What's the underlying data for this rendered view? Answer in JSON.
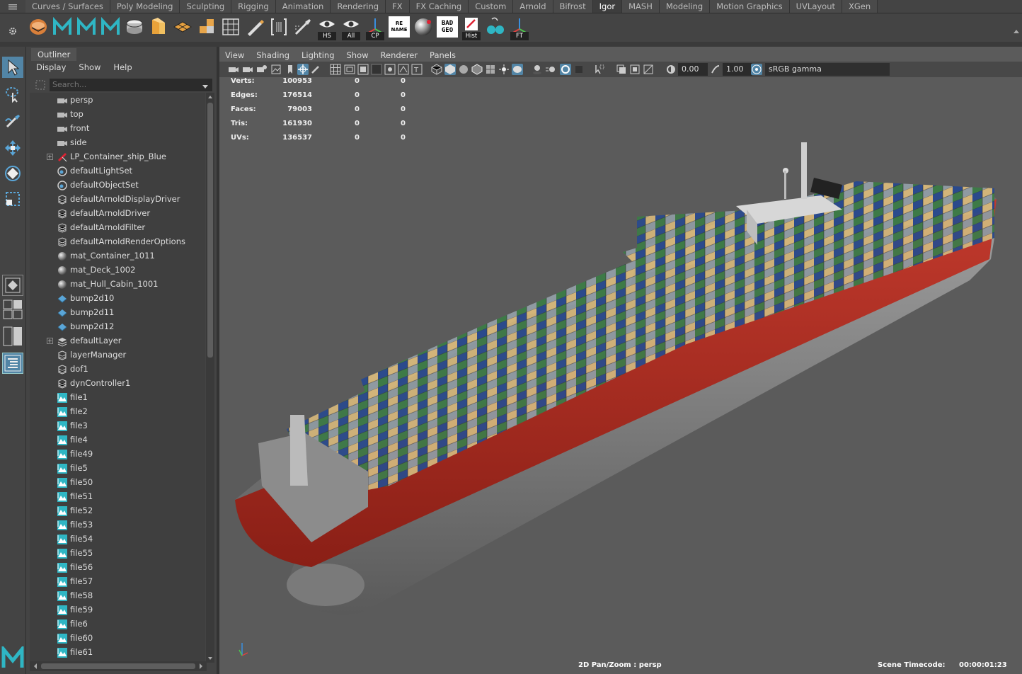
{
  "shelf": {
    "tabs": [
      "Curves / Surfaces",
      "Poly Modeling",
      "Sculpting",
      "Rigging",
      "Animation",
      "Rendering",
      "FX",
      "FX Caching",
      "Custom",
      "Arnold",
      "Bifrost",
      "Igor",
      "MASH",
      "Modeling",
      "Motion Graphics",
      "UVLayout",
      "XGen"
    ],
    "active_tab": "Igor",
    "icon_labels": {
      "hs": "HS",
      "all": "All",
      "cp": "CP",
      "rename": "RE NAME",
      "badgeo": "BAD GEO",
      "hist": "Hist",
      "ft": "FT"
    }
  },
  "outliner": {
    "tab": "Outliner",
    "menu": [
      "Display",
      "Show",
      "Help"
    ],
    "search_placeholder": "Search...",
    "items": [
      {
        "label": "persp",
        "icon": "camera-icon",
        "expandable": false
      },
      {
        "label": "top",
        "icon": "camera-icon",
        "expandable": false
      },
      {
        "label": "front",
        "icon": "camera-icon",
        "expandable": false
      },
      {
        "label": "side",
        "icon": "camera-icon",
        "expandable": false
      },
      {
        "label": "LP_Container_ship_Blue",
        "icon": "mesh-group-icon",
        "expandable": true
      },
      {
        "label": "defaultLightSet",
        "icon": "set-icon",
        "expandable": false
      },
      {
        "label": "defaultObjectSet",
        "icon": "set-icon",
        "expandable": false
      },
      {
        "label": "defaultArnoldDisplayDriver",
        "icon": "node-icon",
        "expandable": false
      },
      {
        "label": "defaultArnoldDriver",
        "icon": "node-icon",
        "expandable": false
      },
      {
        "label": "defaultArnoldFilter",
        "icon": "node-icon",
        "expandable": false
      },
      {
        "label": "defaultArnoldRenderOptions",
        "icon": "node-icon",
        "expandable": false
      },
      {
        "label": "mat_Container_1011",
        "icon": "material-sphere-icon",
        "expandable": false
      },
      {
        "label": "mat_Deck_1002",
        "icon": "material-sphere-icon",
        "expandable": false
      },
      {
        "label": "mat_Hull_Cabin_1001",
        "icon": "material-sphere-icon",
        "expandable": false
      },
      {
        "label": "bump2d10",
        "icon": "bump-icon",
        "expandable": false
      },
      {
        "label": "bump2d11",
        "icon": "bump-icon",
        "expandable": false
      },
      {
        "label": "bump2d12",
        "icon": "bump-icon",
        "expandable": false
      },
      {
        "label": "defaultLayer",
        "icon": "layer-icon",
        "expandable": true
      },
      {
        "label": "layerManager",
        "icon": "node-icon",
        "expandable": false
      },
      {
        "label": "dof1",
        "icon": "node-icon",
        "expandable": false
      },
      {
        "label": "dynController1",
        "icon": "node-icon",
        "expandable": false
      },
      {
        "label": "file1",
        "icon": "file-texture-icon",
        "expandable": false
      },
      {
        "label": "file2",
        "icon": "file-texture-icon",
        "expandable": false
      },
      {
        "label": "file3",
        "icon": "file-texture-icon",
        "expandable": false
      },
      {
        "label": "file4",
        "icon": "file-texture-icon",
        "expandable": false
      },
      {
        "label": "file49",
        "icon": "file-texture-icon",
        "expandable": false
      },
      {
        "label": "file5",
        "icon": "file-texture-icon",
        "expandable": false
      },
      {
        "label": "file50",
        "icon": "file-texture-icon",
        "expandable": false
      },
      {
        "label": "file51",
        "icon": "file-texture-icon",
        "expandable": false
      },
      {
        "label": "file52",
        "icon": "file-texture-icon",
        "expandable": false
      },
      {
        "label": "file53",
        "icon": "file-texture-icon",
        "expandable": false
      },
      {
        "label": "file54",
        "icon": "file-texture-icon",
        "expandable": false
      },
      {
        "label": "file55",
        "icon": "file-texture-icon",
        "expandable": false
      },
      {
        "label": "file56",
        "icon": "file-texture-icon",
        "expandable": false
      },
      {
        "label": "file57",
        "icon": "file-texture-icon",
        "expandable": false
      },
      {
        "label": "file58",
        "icon": "file-texture-icon",
        "expandable": false
      },
      {
        "label": "file59",
        "icon": "file-texture-icon",
        "expandable": false
      },
      {
        "label": "file6",
        "icon": "file-texture-icon",
        "expandable": false
      },
      {
        "label": "file60",
        "icon": "file-texture-icon",
        "expandable": false
      },
      {
        "label": "file61",
        "icon": "file-texture-icon",
        "expandable": false
      }
    ]
  },
  "viewport": {
    "menu": [
      "View",
      "Shading",
      "Lighting",
      "Show",
      "Renderer",
      "Panels"
    ],
    "exposure": "0.00",
    "gamma": "1.00",
    "color_space": "sRGB gamma",
    "hud": [
      {
        "label": "Verts:",
        "value": "100953",
        "sel": "0",
        "other": "0"
      },
      {
        "label": "Edges:",
        "value": "176514",
        "sel": "0",
        "other": "0"
      },
      {
        "label": "Faces:",
        "value": "79003",
        "sel": "0",
        "other": "0"
      },
      {
        "label": "Tris:",
        "value": "161930",
        "sel": "0",
        "other": "0"
      },
      {
        "label": "UVs:",
        "value": "136537",
        "sel": "0",
        "other": "0"
      }
    ],
    "status_left": "2D Pan/Zoom : persp",
    "timecode_label": "Scene Timecode:",
    "timecode": "00:00:01:23"
  },
  "colors": {
    "accent": "#5285a6",
    "hull_red": "#b0281d",
    "hull_grey": "#8d8d8d",
    "maya_teal": "#2fb6c4"
  }
}
